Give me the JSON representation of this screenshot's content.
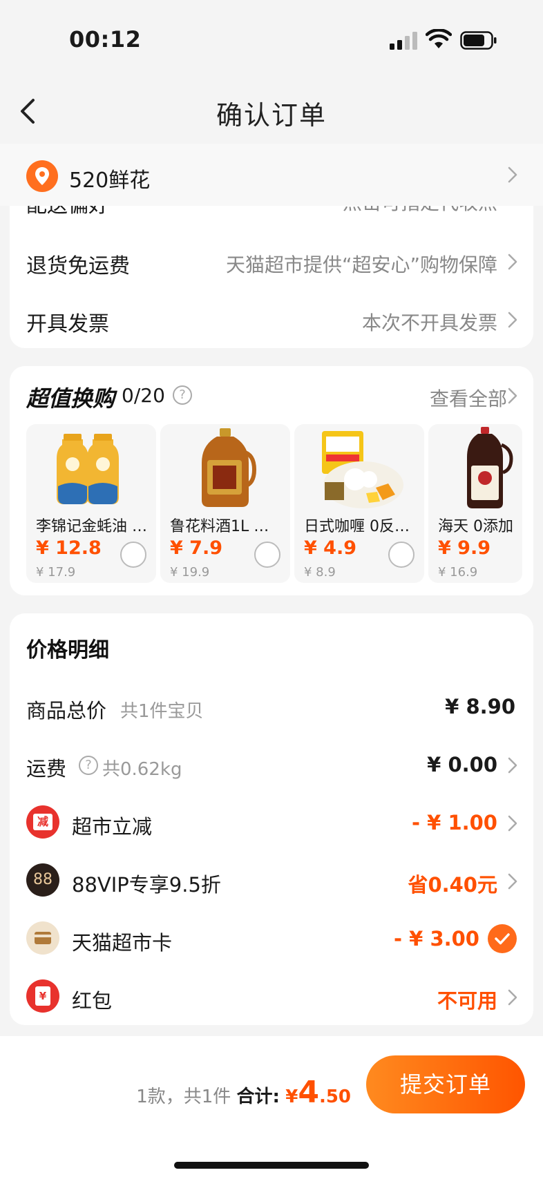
{
  "status_bar": {
    "time": "00:12"
  },
  "nav": {
    "title": "确认订单"
  },
  "address": {
    "text": "520鲜花"
  },
  "service_rows": {
    "delivery": {
      "label": "配送偏好",
      "value": "点击可指定代收点"
    },
    "return": {
      "label": "退货免运费",
      "value": "天猫超市提供“超安心”购物保障"
    },
    "invoice": {
      "label": "开具发票",
      "value": "本次不开具发票"
    }
  },
  "swap": {
    "title": "超值换购",
    "count": "0/20",
    "view_all": "查看全部",
    "products": [
      {
        "name": "李锦记金蚝油 …",
        "price": "¥ 12.8",
        "orig": "¥ 17.9"
      },
      {
        "name": "鲁花料酒1L …",
        "price": "¥ 7.9",
        "orig": "¥ 19.9"
      },
      {
        "name": "日式咖喱 0反…",
        "price": "¥ 4.9",
        "orig": "¥ 8.9"
      },
      {
        "name": "海天 0添加",
        "price": "¥ 9.9",
        "orig": "¥ 16.9"
      }
    ]
  },
  "price_detail": {
    "title": "价格明细",
    "total": {
      "label": "商品总价",
      "sub": "共1件宝贝",
      "value": "¥ 8.90"
    },
    "shipping": {
      "label": "运费",
      "sub": "共0.62kg",
      "value": "¥ 0.00"
    },
    "discount": {
      "icon_text": "减",
      "label": "超市立减",
      "value": "- ¥ 1.00"
    },
    "vip": {
      "icon_text": "88",
      "label": "88VIP专享9.5折",
      "value": "省0.40元"
    },
    "card": {
      "label": "天猫超市卡",
      "value": "- ¥ 3.00"
    },
    "redpacket": {
      "icon_text": "¥",
      "label": "红包",
      "value": "不可用"
    }
  },
  "bottom": {
    "summary": "1款，共1件",
    "total_label": "合计:",
    "currency": "¥",
    "total_int": "4",
    "total_dec": ".50",
    "submit": "提交订单"
  },
  "colors": {
    "accent": "#ff5000",
    "accent_light": "#ff8a1f"
  }
}
